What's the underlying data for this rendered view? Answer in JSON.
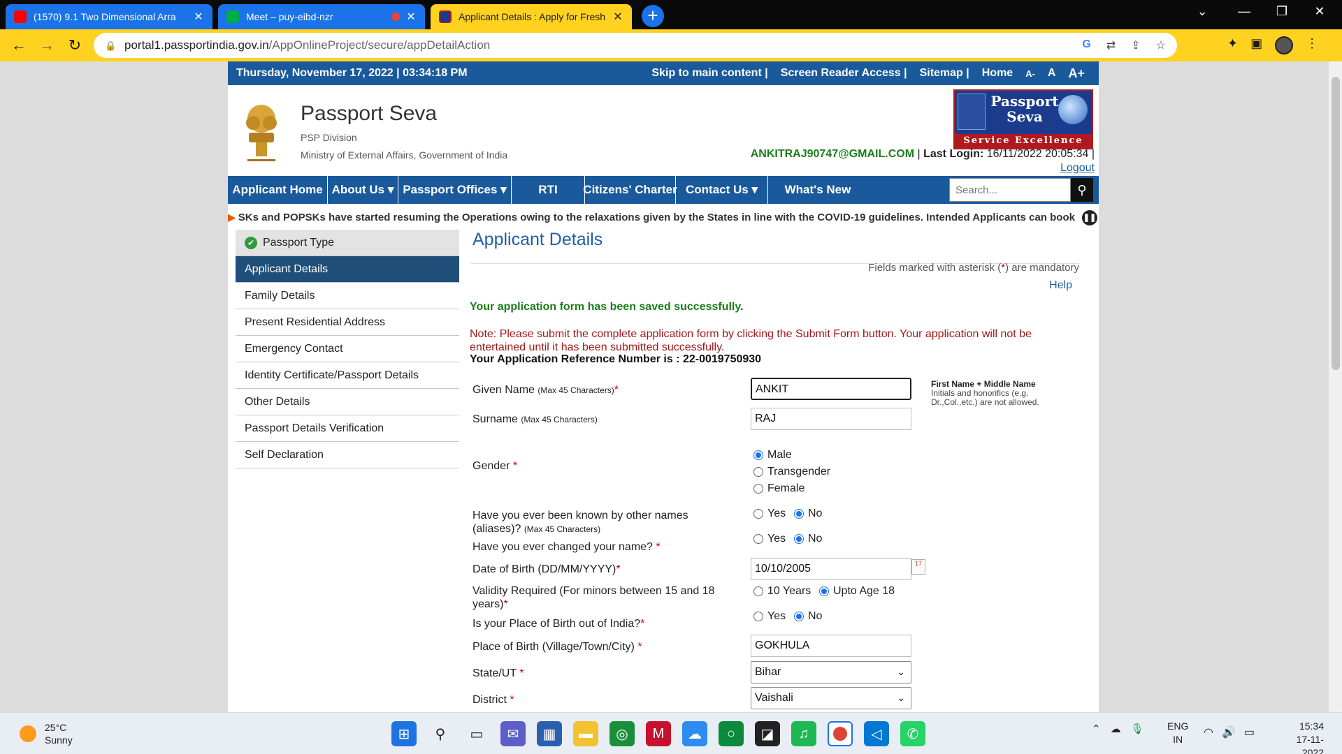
{
  "browser": {
    "tabs": [
      {
        "title": "(1570) 9.1 Two Dimensional Arra",
        "icon": "youtube-icon"
      },
      {
        "title": "Meet – puy-eibd-nzr",
        "icon": "google-meet-icon"
      },
      {
        "title": "Applicant Details : Apply for Fresh",
        "icon": "passport-seva-icon"
      }
    ],
    "url_host": "portal1.passportindia.gov.in",
    "url_path": "/AppOnlineProject/secure/appDetailAction"
  },
  "site": {
    "datetime": "Thursday,  November  17, 2022 | 03:34:18 PM",
    "top_links": [
      "Skip to main content  |",
      "Screen Reader Access  |",
      "Sitemap  |",
      "Home",
      "A-",
      "A",
      "A+"
    ],
    "title": "Passport Seva",
    "sub1": "PSP Division",
    "sub2": "Ministry of External Affairs, Government of India",
    "logo_title": "Passport Seva",
    "logo_strip": "Service Excellence",
    "email": "ANKITRAJ90747@GMAIL.COM",
    "last_login_label": "Last Login:",
    "last_login_value": "16/11/2022 20:05:34",
    "logout": "Logout",
    "nav": [
      "Applicant Home",
      "About Us ▾",
      "Passport Offices ▾",
      "RTI",
      "Citizens' Charter",
      "Contact Us ▾",
      "What's New"
    ],
    "search_placeholder": "Search...",
    "ticker": "SKs and POPSKs have started resuming the Operations owing to the relaxations given by the States in line with the COVID-19 guidelines. Intended Applicants can book"
  },
  "sidebar": {
    "items": [
      "Passport Type",
      "Applicant Details",
      "Family Details",
      "Present Residential Address",
      "Emergency Contact",
      "Identity Certificate/Passport Details",
      "Other Details",
      "Passport Details Verification",
      "Self Declaration"
    ]
  },
  "form": {
    "title": "Applicant Details",
    "mandatory_pre": "Fields marked with asterisk (",
    "mandatory_ast": "*",
    "mandatory_post": ") are mandatory",
    "help": "Help",
    "saved": "Your application form has been saved successfully.",
    "note": "Note: Please submit the complete application form by clicking the Submit Form button. Your application will not be entertained until it has been submitted successfully.",
    "refno": "Your Application Reference Number is : 22-0019750930",
    "given_name_label": "Given Name",
    "given_name_hint": "(Max 45 Characters)",
    "given_name": "ANKIT",
    "surname_label": "Surname",
    "surname_hint": "(Max 45 Characters)",
    "surname": "RAJ",
    "hint_title": "First Name + Middle Name",
    "hint_text": "Initials and honorifics (e.g. Dr.,Col.,etc.) are not allowed.",
    "gender_label": "Gender",
    "gender_options": [
      "Male",
      "Transgender",
      "Female"
    ],
    "gender_selected": "Male",
    "aliases_label": "Have you ever been known by other names (aliases)?",
    "aliases_hint": "(Max 45 Characters)",
    "changed_name_label": "Have you ever changed your name?",
    "yes": "Yes",
    "no": "No",
    "dob_label": "Date of Birth (DD/MM/YYYY)",
    "dob": "10/10/2005",
    "validity_label": "Validity Required (For minors between 15 and 18 years)",
    "validity_options": [
      "10 Years",
      "Upto Age 18"
    ],
    "validity_selected": "Upto Age 18",
    "pob_out_label": "Is your Place of Birth out of India?",
    "pob_label": "Place of Birth (Village/Town/City)",
    "pob": "GOKHULA",
    "state_label": "State/UT",
    "state": "Bihar",
    "district_label": "District",
    "district": "Vaishali"
  },
  "taskbar": {
    "temp": "25°C",
    "weather": "Sunny",
    "lang1": "ENG",
    "lang2": "IN",
    "time": "15:34",
    "date": "17-11-2022"
  },
  "colors": {
    "brand_blue": "#1a5a9c",
    "active_sidebar": "#1f4e79",
    "success_green": "#1a7d1a",
    "note_red": "#a01818",
    "chrome_accent": "#ffd21f"
  }
}
